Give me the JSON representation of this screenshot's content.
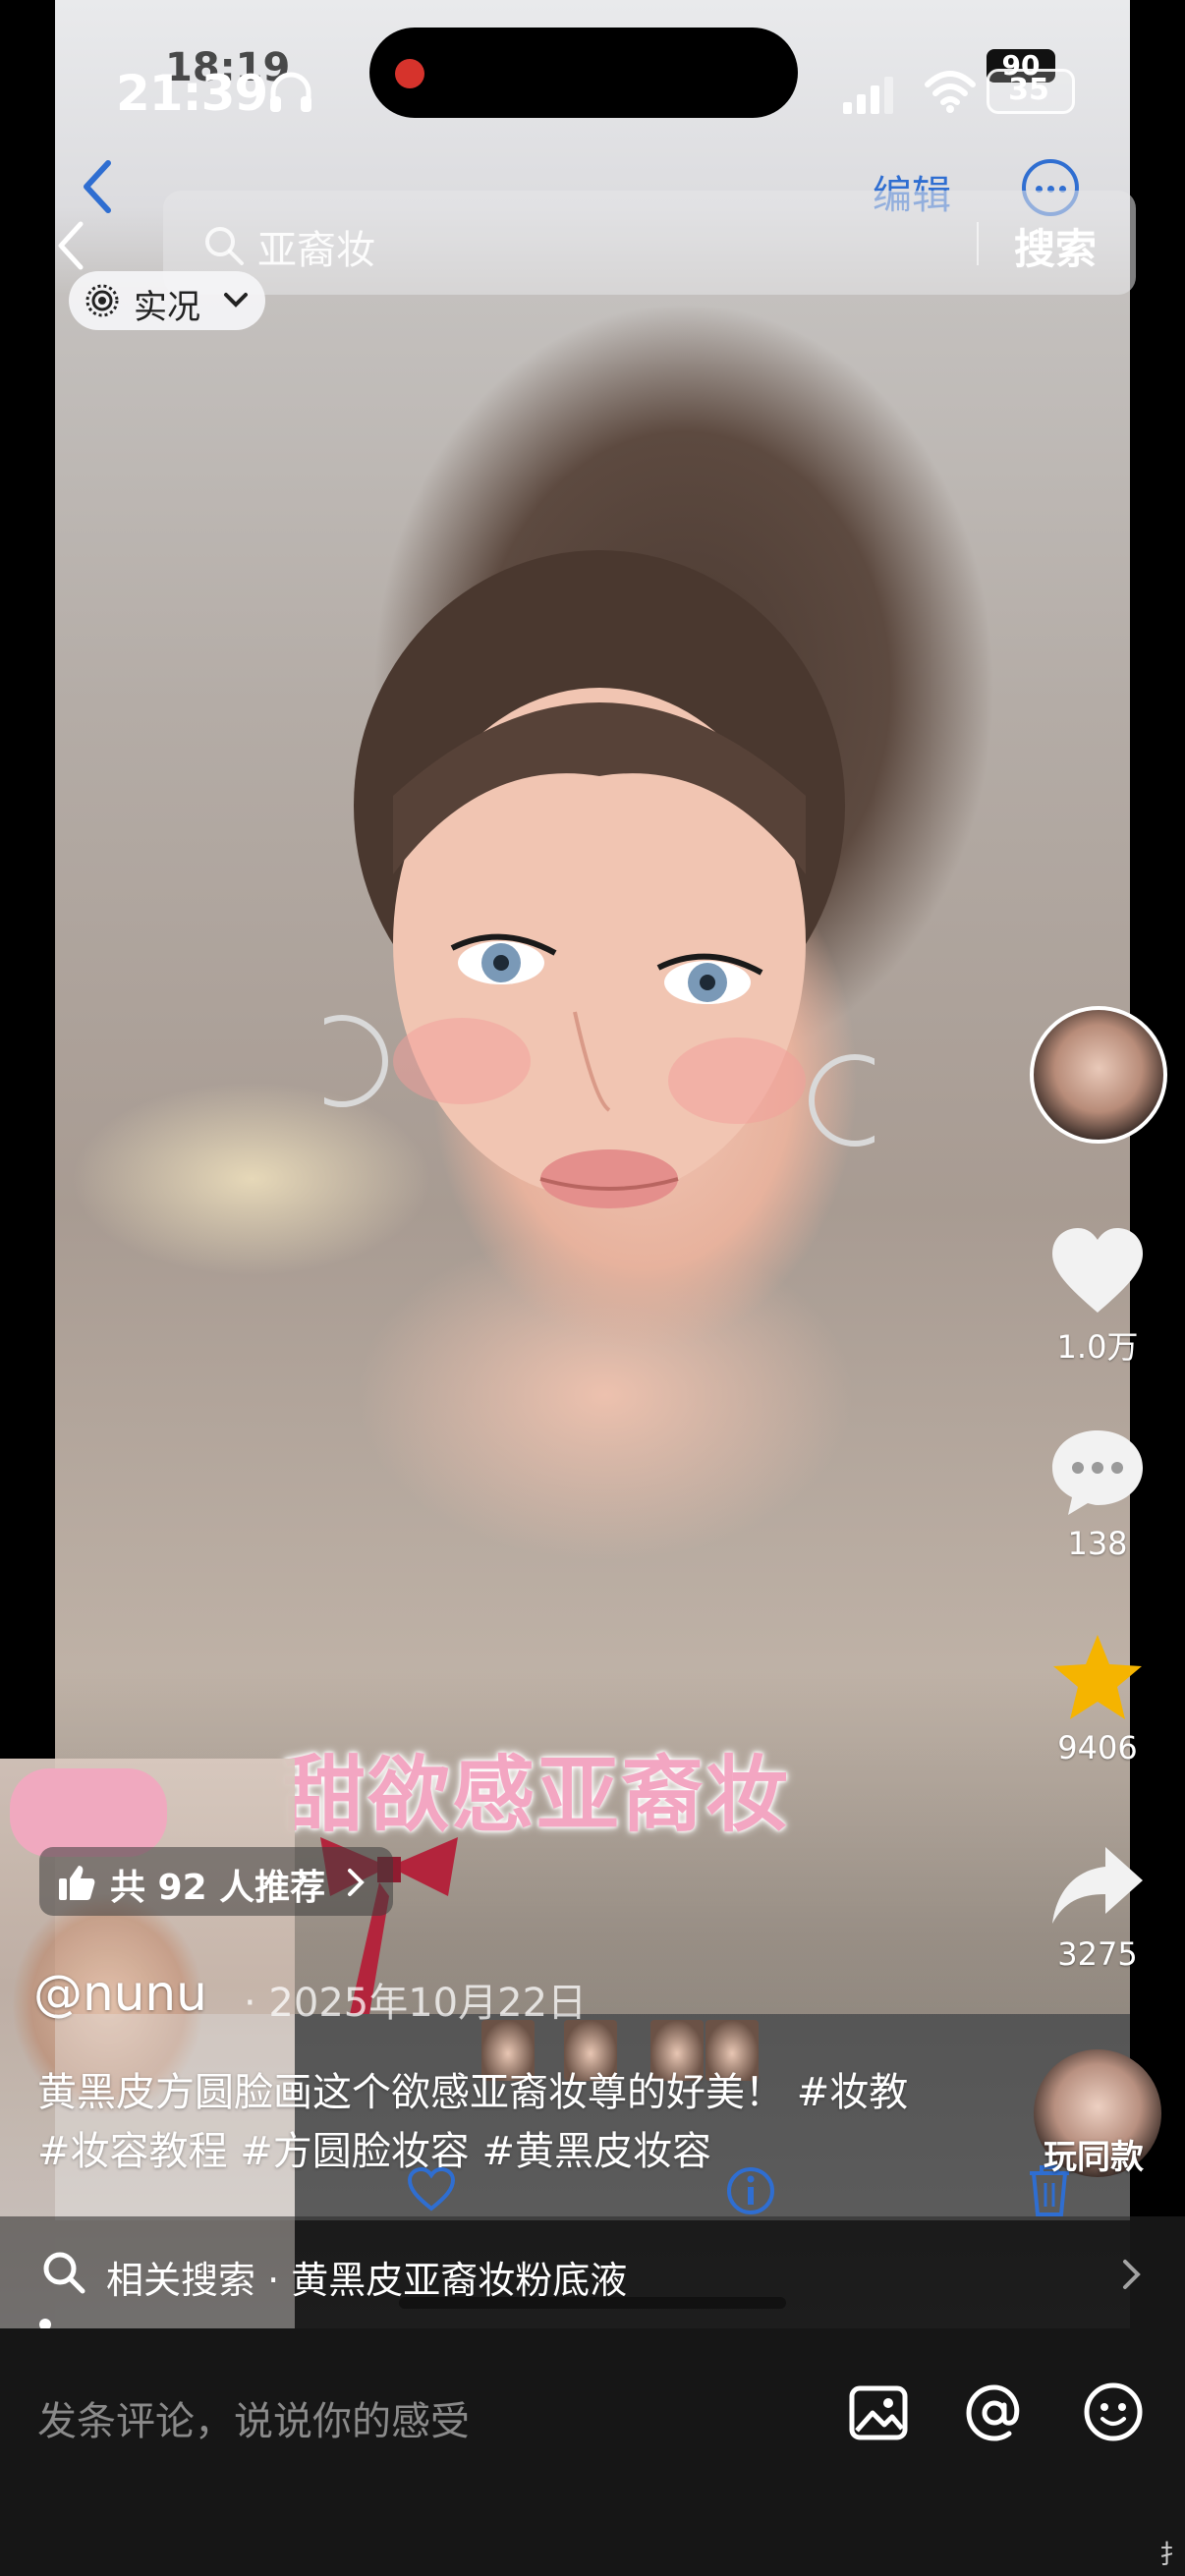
{
  "status_bar": {
    "time": "21:39",
    "time_behind": "18:19",
    "battery": "35",
    "battery_behind": "90"
  },
  "underlying_nav": {
    "edit_label": "编辑"
  },
  "search": {
    "query": "亚裔妆",
    "submit_label": "搜索"
  },
  "live_chip": {
    "label": "实况"
  },
  "video": {
    "overlay_title": "甜欲感亚裔妆"
  },
  "actions": {
    "likes": "1.0万",
    "comments": "138",
    "favorites": "9406",
    "shares": "3275"
  },
  "recommend": {
    "label": "共 92 人推荐"
  },
  "post": {
    "author": "@nunu",
    "date": "· 2025年10月22日",
    "caption": "黄黑皮方圆脸画这个欲感亚裔妆尊的好美！ #妆教 #妆容教程 #方圆脸妆容 #黄黑皮妆容"
  },
  "same_style": {
    "label": "玩同款"
  },
  "related": {
    "label": "相关搜索 · 黄黑皮亚裔妆粉底液"
  },
  "comment": {
    "placeholder": "发条评论，说说你的感受"
  },
  "corner_glyph": "扌",
  "colors": {
    "accent_blue": "#2f6ed1",
    "favorite_star": "#f5b400",
    "title_pink": "#f3a6c2",
    "comment_bar": "#161616"
  }
}
